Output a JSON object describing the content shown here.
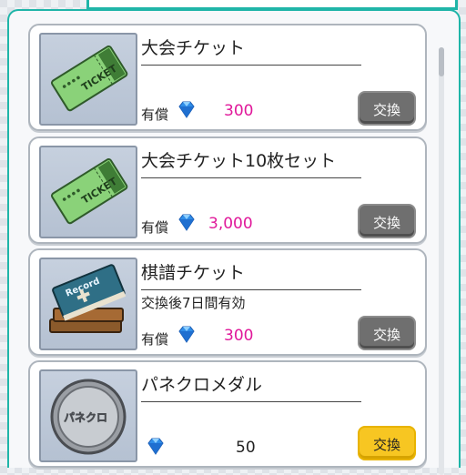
{
  "shop": {
    "items": [
      {
        "title": "大会チケット",
        "subtitle": "",
        "cost_label": "有償",
        "price": "300",
        "button": "交換",
        "icon": "ticket-icon"
      },
      {
        "title": "大会チケット10枚セット",
        "subtitle": "",
        "cost_label": "有償",
        "price": "3,000",
        "button": "交換",
        "icon": "ticket-icon"
      },
      {
        "title": "棋譜チケット",
        "subtitle": "交換後7日間有効",
        "cost_label": "有償",
        "price": "300",
        "button": "交換",
        "icon": "record-books-icon"
      },
      {
        "title": "パネクロメダル",
        "subtitle": "",
        "cost_label": "",
        "price": "50",
        "button": "交換",
        "icon": "medal-icon"
      }
    ]
  },
  "art": {
    "ticket_text": "TICKET",
    "record_text": "Record",
    "medal_text": "パネクロ"
  },
  "colors": {
    "accent": "#1fb5a8",
    "price": "#e0189a",
    "button_disabled": "#6f6f6f",
    "button_active": "#f7c622"
  }
}
